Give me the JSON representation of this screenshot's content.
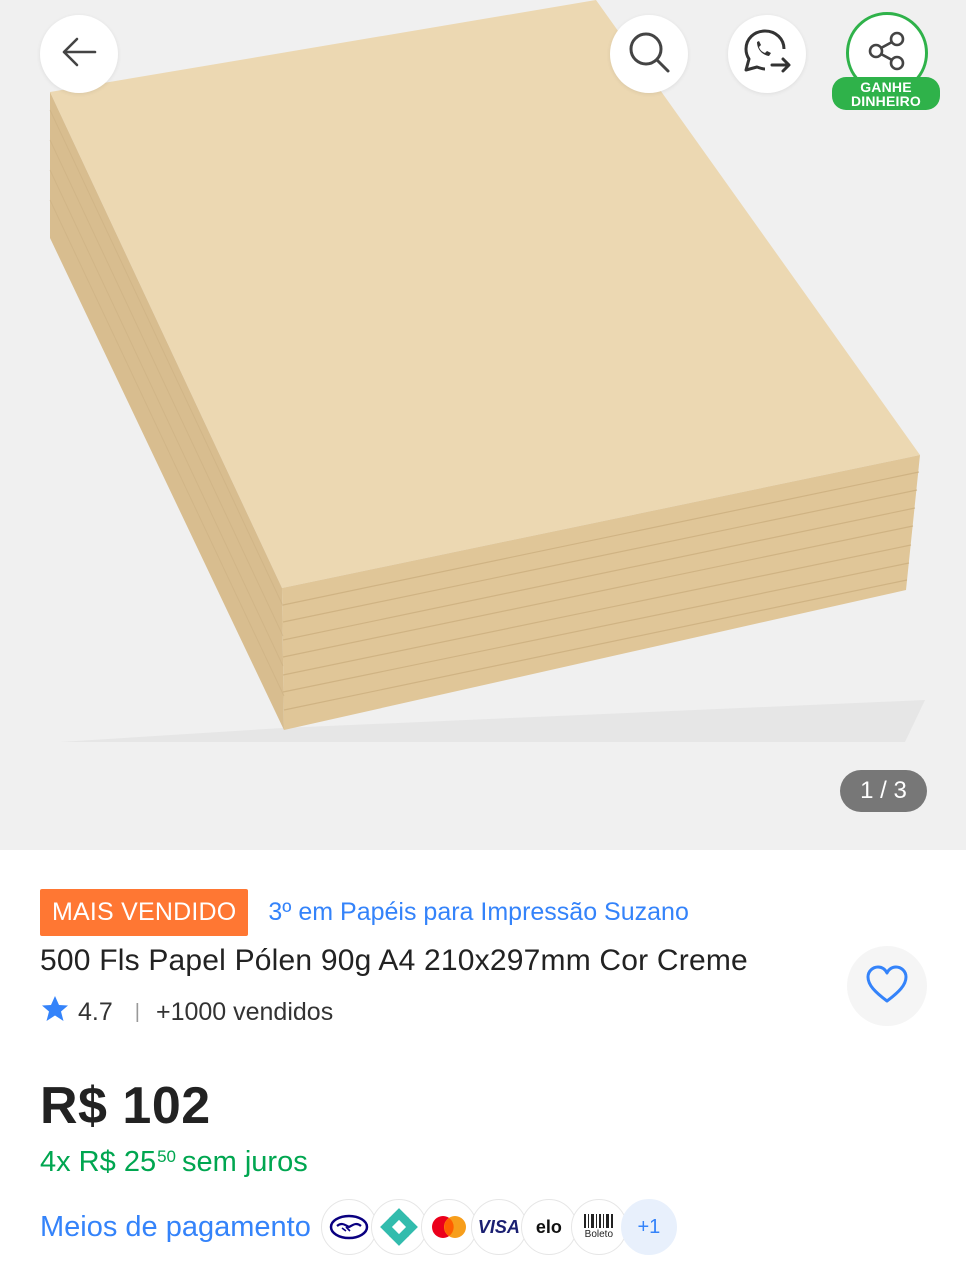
{
  "gallery": {
    "counter": "1 / 3",
    "share_badge_line1": "GANHE",
    "share_badge_line2": "DINHEIRO"
  },
  "product": {
    "best_seller_badge": "MAIS VENDIDO",
    "ranking_link": "3º em Papéis para Impressão Suzano",
    "title": "500 Fls Papel Pólen 90g A4 210x297mm Cor Creme",
    "rating": "4.7",
    "sold": "+1000 vendidos",
    "price": "R$ 102",
    "installments_prefix": "4x R$ 25",
    "installments_cents": "50",
    "installments_suffix": "sem juros",
    "payment_label": "Meios de pagamento",
    "payment_methods": [
      "mercado-pago",
      "pix",
      "mastercard",
      "VISA",
      "elo",
      "Boleto"
    ],
    "payment_more": "+1"
  },
  "colors": {
    "accent_blue": "#3483fa",
    "green": "#00a650",
    "badge_orange": "#ff7733",
    "share_green": "#2fb24a"
  },
  "icons": [
    "back-arrow-icon",
    "search-icon",
    "whatsapp-share-icon",
    "share-icon",
    "heart-icon",
    "star-icon"
  ]
}
